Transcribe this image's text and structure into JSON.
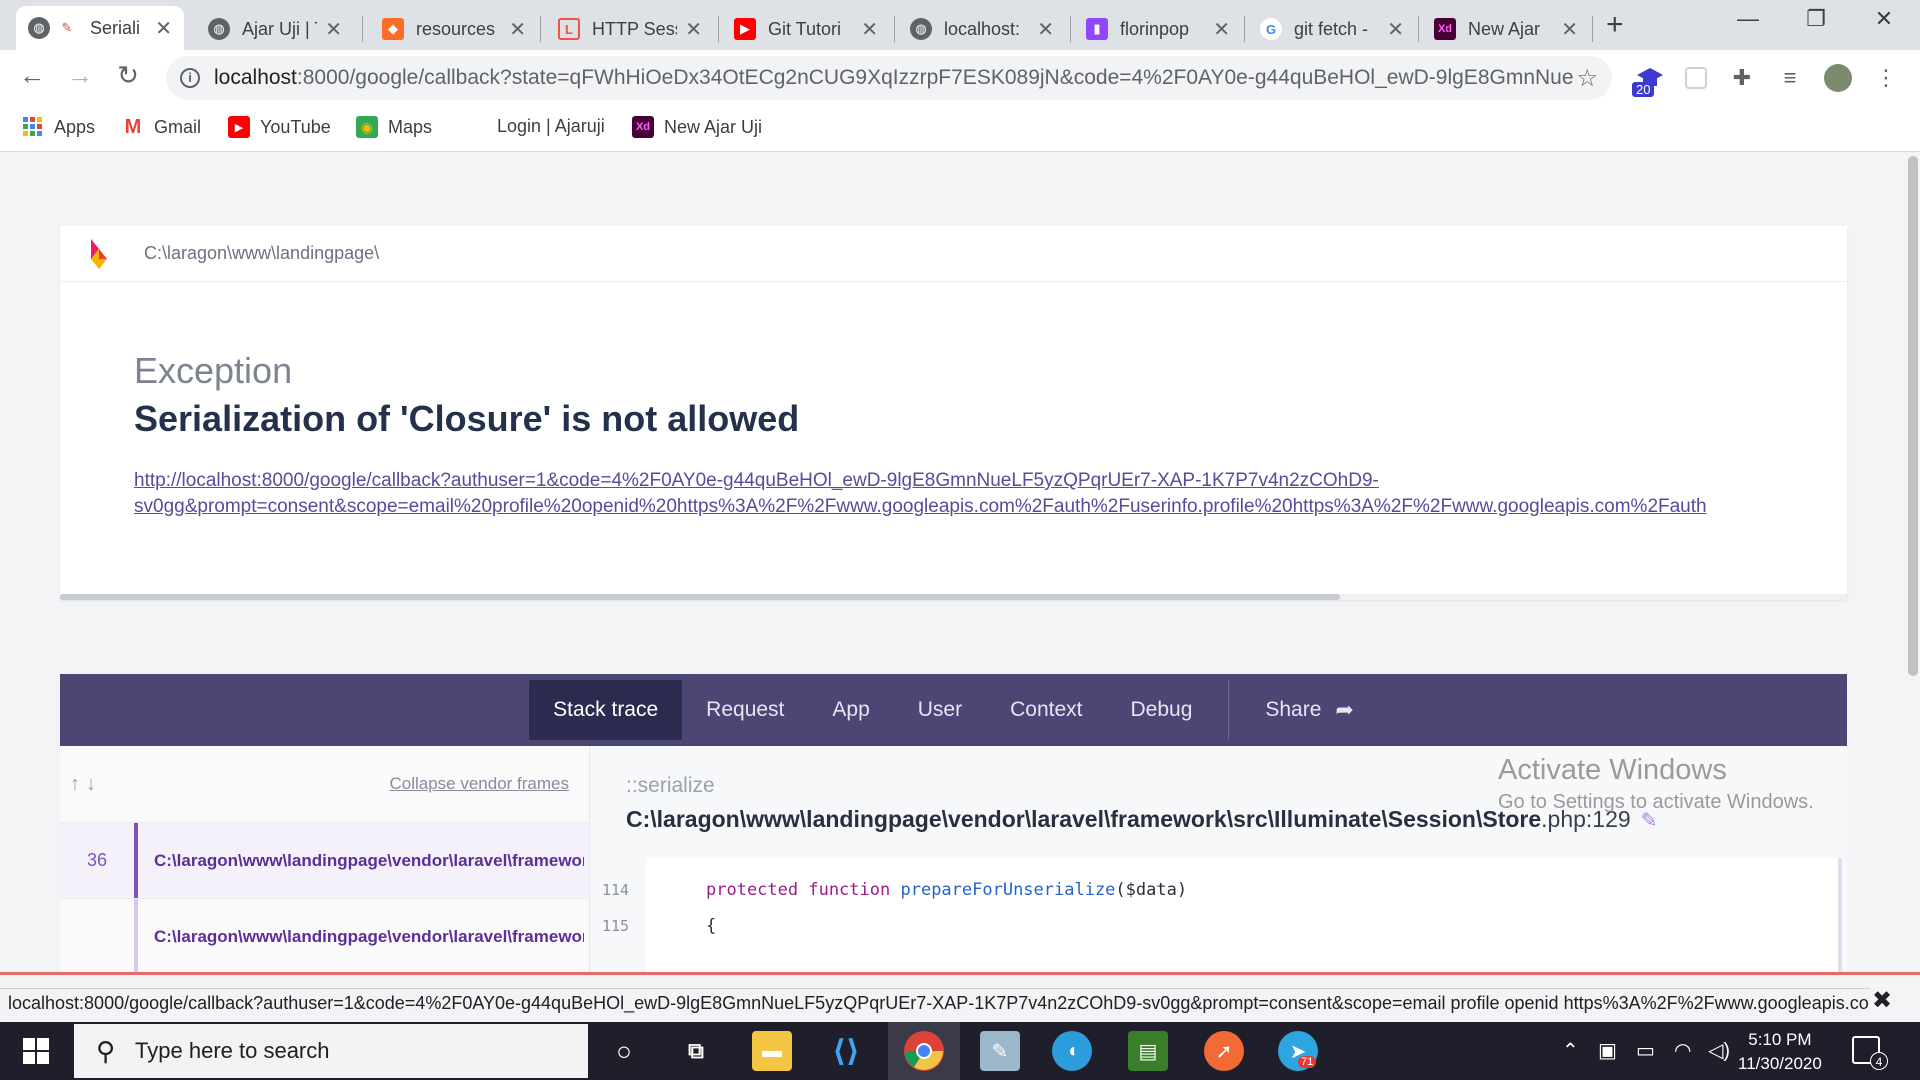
{
  "browser": {
    "tabs": [
      {
        "title": "Seriali",
        "icon": "globe-icon",
        "active": true
      },
      {
        "title": "Ajar Uji | T",
        "icon": "globe-icon"
      },
      {
        "title": "resources",
        "icon": "gitlab-icon"
      },
      {
        "title": "HTTP Sess",
        "icon": "laravel-icon"
      },
      {
        "title": "Git Tutori",
        "icon": "youtube-icon"
      },
      {
        "title": "localhost:",
        "icon": "globe-icon"
      },
      {
        "title": "florinpop",
        "icon": "twitch-icon"
      },
      {
        "title": "git fetch -",
        "icon": "google-icon"
      },
      {
        "title": "New Ajar",
        "icon": "xd-icon"
      }
    ],
    "new_tab_label": "+",
    "url_host": "localhost",
    "url_rest": ":8000/google/callback?state=qFWhHiOeDx34OtECg2nCUG9XqIzzrpF7ESK089jN&code=4%2F0AY0e-g44quBeHOl_ewD-9lgE8GmnNue...",
    "extension_badge": "20",
    "bookmarks": [
      {
        "label": "Apps",
        "icon": "apps-grid-icon"
      },
      {
        "label": "Gmail",
        "icon": "gmail-icon"
      },
      {
        "label": "YouTube",
        "icon": "youtube-icon"
      },
      {
        "label": "Maps",
        "icon": "maps-icon"
      },
      {
        "label": "Login | Ajaruji",
        "icon": ""
      },
      {
        "label": "New Ajar Uji",
        "icon": "xd-icon"
      }
    ]
  },
  "error_page": {
    "app_path": "C:\\laragon\\www\\landingpage\\",
    "exception_class": "Exception",
    "message": "Serialization of 'Closure' is not allowed",
    "url_line1": "http://localhost:8000/google/callback?authuser=1&code=4%2F0AY0e-g44quBeHOl_ewD-9lgE8GmnNueLF5yzQPqrUEr7-XAP-1K7P7v4n2zCOhD9-",
    "url_line2": "sv0gg&prompt=consent&scope=email%20profile%20openid%20https%3A%2F%2Fwww.googleapis.com%2Fauth%2Fuserinfo.profile%20https%3A%2F%2Fwww.googleapis.com%2Fauth",
    "tabs": [
      "Stack trace",
      "Request",
      "App",
      "User",
      "Context",
      "Debug"
    ],
    "share_label": "Share",
    "collapse_label": "Collapse vendor frames",
    "frames": [
      {
        "number": "36",
        "path": "C:\\laragon\\www\\landingpage\\vendor\\laravel\\framework\\src\\Illuminate"
      },
      {
        "number": "",
        "path": "C:\\laragon\\www\\landingpage\\vendor\\laravel\\framework\\src\\Illuminate"
      }
    ],
    "method": "::serialize",
    "file_path": "C:\\laragon\\www\\landingpage\\vendor\\laravel\\framework\\src\\Illuminate\\Session\\Store",
    "file_ext": ".php",
    "file_line": ":129",
    "code": [
      {
        "ln": "114",
        "kw": "protected function",
        "fn": "prepareForUnserialize",
        "rest": "($data)"
      },
      {
        "ln": "115",
        "kw": "",
        "fn": "",
        "rest": "{"
      }
    ]
  },
  "watermark": {
    "line1": "Activate Windows",
    "line2": "Go to Settings to activate Windows."
  },
  "status_bar": {
    "url": "localhost:8000/google/callback?authuser=1&code=4%2F0AY0e-g44quBeHOl_ewD-9lgE8GmnNueLF5yzQPqrUEr7-XAP-1K7P7v4n2zCOhD9-sv0gg&prompt=consent&scope=email profile openid https%3A%2F%2Fwww.googleapis.co..."
  },
  "taskbar": {
    "search_placeholder": "Type here to search",
    "time": "5:10 PM",
    "date": "11/30/2020",
    "notification_count": "4",
    "telegram_badge": "71"
  },
  "colors": {
    "navbar": "#4b4674",
    "navbar_active": "#2c2a4e",
    "frame_accent": "#7c53b8"
  }
}
